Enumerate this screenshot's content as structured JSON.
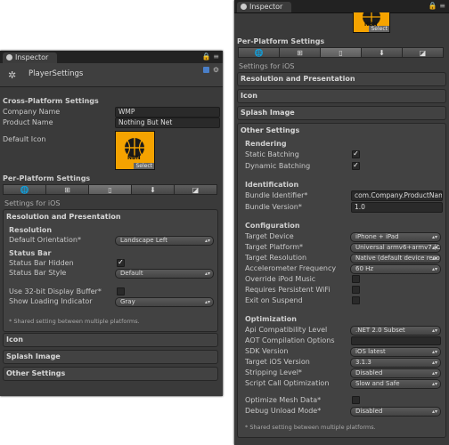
{
  "left": {
    "tab_label": "Inspector",
    "title": "PlayerSettings",
    "cross_platform": {
      "header": "Cross-Platform Settings",
      "company_label": "Company Name",
      "company_value": "WMP",
      "product_label": "Product Name",
      "product_value": "Nothing But Net",
      "icon_label": "Default Icon",
      "icon_caption": "Select"
    },
    "per_platform_header": "Per-Platform Settings",
    "settings_for": "Settings for iOS",
    "resolution": {
      "title": "Resolution and Presentation",
      "sub_resolution": "Resolution",
      "orientation_label": "Default Orientation*",
      "orientation_value": "Landscape Left",
      "sub_status_bar": "Status Bar",
      "hidden_label": "Status Bar Hidden",
      "style_label": "Status Bar Style",
      "style_value": "Default",
      "display_buffer_label": "Use 32-bit Display Buffer*",
      "loading_label": "Show Loading Indicator",
      "loading_value": "Gray",
      "note": "* Shared setting between multiple platforms."
    },
    "icon_section": "Icon",
    "splash_section": "Splash Image",
    "other_section": "Other Settings"
  },
  "right": {
    "tab_label": "Inspector",
    "icon_caption": "Select",
    "per_platform_header": "Per-Platform Settings",
    "settings_for": "Settings for iOS",
    "resolution_section": "Resolution and Presentation",
    "icon_section": "Icon",
    "splash_section": "Splash Image",
    "other": {
      "title": "Other Settings",
      "rendering": "Rendering",
      "static_batching": "Static Batching",
      "dynamic_batching": "Dynamic Batching",
      "identification": "Identification",
      "bundle_id_label": "Bundle Identifier*",
      "bundle_id_value": "com.Company.ProductNam",
      "bundle_version_label": "Bundle Version*",
      "bundle_version_value": "1.0",
      "configuration": "Configuration",
      "target_device_label": "Target Device",
      "target_device_value": "iPhone + iPad",
      "target_platform_label": "Target Platform*",
      "target_platform_value": "Universal armv6+armv7 (Opti",
      "target_resolution_label": "Target Resolution",
      "target_resolution_value": "Native (default device resolu",
      "accel_label": "Accelerometer Frequency",
      "accel_value": "60 Hz",
      "ipod_label": "Override iPod Music",
      "wifi_label": "Requires Persistent WiFi",
      "exit_label": "Exit on Suspend",
      "optimization": "Optimization",
      "api_label": "Api Compatibility Level",
      "api_value": ".NET 2.0 Subset",
      "aot_label": "AOT Compilation Options",
      "sdk_label": "SDK Version",
      "sdk_value": "iOS latest",
      "target_ios_label": "Target iOS Version",
      "target_ios_value": "3.1.3",
      "stripping_label": "Stripping Level*",
      "stripping_value": "Disabled",
      "script_call_label": "Script Call Optimization",
      "script_call_value": "Slow and Safe",
      "mesh_label": "Optimize Mesh Data*",
      "debug_label": "Debug Unload Mode*",
      "debug_value": "Disabled",
      "note": "* Shared setting between multiple platforms."
    }
  },
  "colors": {
    "panel_bg": "#3a3a3a",
    "field_bg": "#2a2a2a",
    "icon_orange": "#f5a300"
  }
}
